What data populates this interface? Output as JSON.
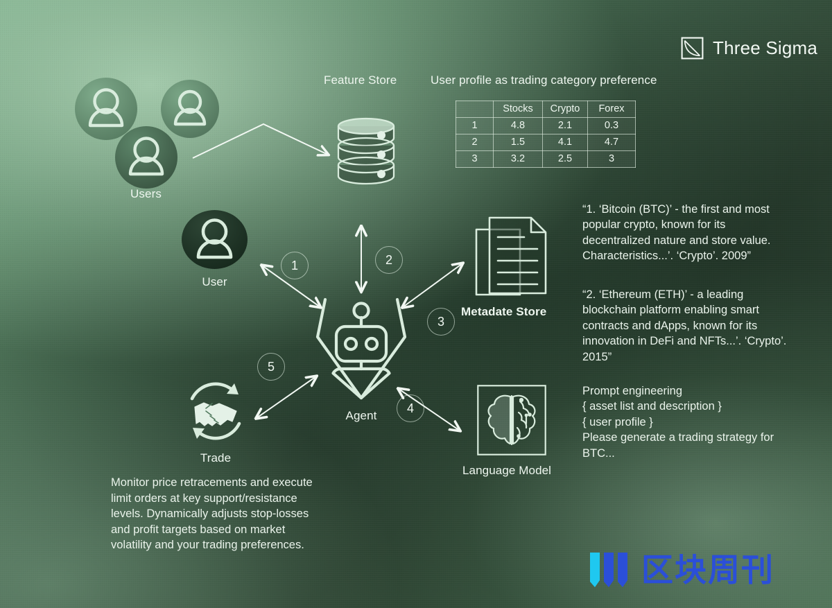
{
  "brand": {
    "name": "Three Sigma",
    "logo_icon": "three-sigma-square-curve-icon"
  },
  "watermark": {
    "text": "区块周刊",
    "logo_icon": "three-bars-icon",
    "colors": {
      "cyan": "#1fc8f0",
      "blue": "#2b4fd8"
    }
  },
  "palette": {
    "stroke": "#d9ecdd",
    "text": "#eef6ef",
    "bg_dark": "#2b402f",
    "bg_light": "#83b391"
  },
  "nodes": {
    "users": {
      "label": "Users",
      "icon": "user-group-icon"
    },
    "feature_store": {
      "label": "Feature Store",
      "icon": "database-icon"
    },
    "user": {
      "label": "User",
      "icon": "user-avatar-icon"
    },
    "agent": {
      "label": "Agent",
      "icon": "robot-agent-icon"
    },
    "metadate_store": {
      "label": "Metadate Store",
      "icon": "documents-icon"
    },
    "language_model": {
      "label": "Language Model",
      "icon": "brain-circuit-icon"
    },
    "trade": {
      "label": "Trade",
      "icon": "handshake-refresh-icon"
    }
  },
  "table": {
    "caption": "User profile as trading category preference",
    "columns": [
      "",
      "Stocks",
      "Crypto",
      "Forex"
    ],
    "rows": [
      {
        "id": "1",
        "stocks": "4.8",
        "crypto": "2.1",
        "forex": "0.3"
      },
      {
        "id": "2",
        "stocks": "1.5",
        "crypto": "4.1",
        "forex": "4.7"
      },
      {
        "id": "3",
        "stocks": "3.2",
        "crypto": "2.5",
        "forex": "3"
      }
    ]
  },
  "edges": [
    {
      "number": "1",
      "from": "user",
      "to": "agent",
      "direction": "bidirectional"
    },
    {
      "number": "2",
      "from": "feature_store",
      "to": "agent",
      "direction": "bidirectional"
    },
    {
      "number": "3",
      "from": "metadate_store",
      "to": "agent",
      "direction": "bidirectional"
    },
    {
      "number": "4",
      "from": "language_model",
      "to": "agent",
      "direction": "bidirectional"
    },
    {
      "number": "5",
      "from": "trade",
      "to": "agent",
      "direction": "bidirectional"
    }
  ],
  "texts": {
    "bitcoin_desc": "“1. ‘Bitcoin (BTC)’ - the first and most popular crypto, known for its decentralized nature and store value. Characteristics...’. ‘Crypto’. 2009”",
    "ethereum_desc": "“2. ‘Ethereum (ETH)’ - a leading blockchain platform enabling smart contracts and dApps, known for its innovation in DeFi and NFTs...’. ‘Crypto’. 2015”",
    "prompt_engineering": [
      "Prompt engineering",
      "{ asset list and description }",
      "{ user profile }",
      "Please generate a trading strategy for",
      "BTC..."
    ],
    "strategy_desc": "Monitor price retracements and execute limit orders at key support/resistance levels. Dynamically adjusts stop-losses and profit targets based on market volatility and your trading preferences."
  }
}
